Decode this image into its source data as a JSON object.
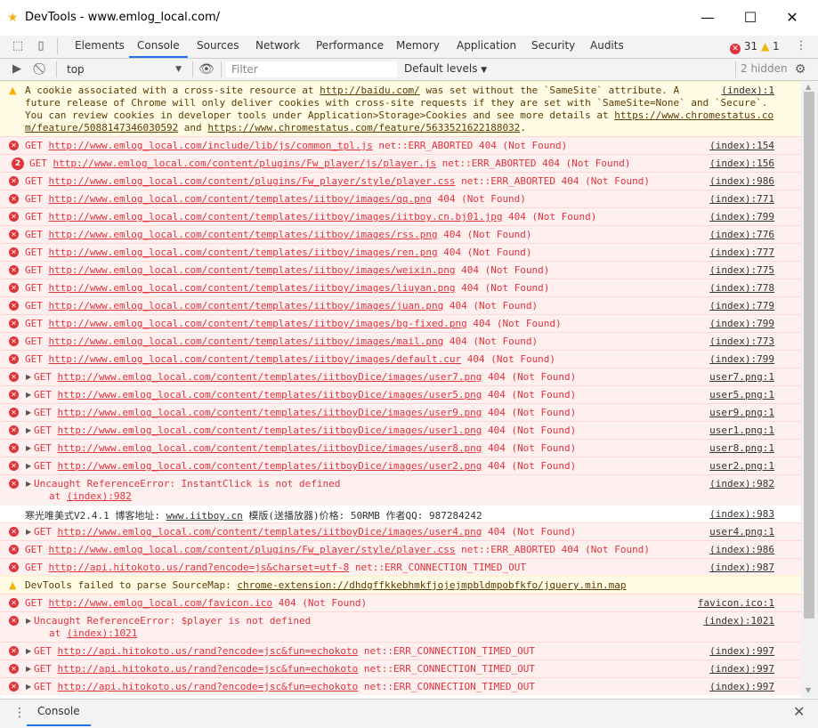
{
  "window": {
    "title": "DevTools - www.emlog_local.com/",
    "minimize": "—",
    "maximize": "☐",
    "close": "✕"
  },
  "tabs": [
    "Elements",
    "Console",
    "Sources",
    "Network",
    "Performance",
    "Memory",
    "Application",
    "Security",
    "Audits"
  ],
  "active_tab": "Console",
  "counters": {
    "errors": "31",
    "warnings": "1"
  },
  "toolbar": {
    "context": "top",
    "filter_placeholder": "Filter",
    "levels": "Default levels",
    "hidden": "2 hidden"
  },
  "colors": {
    "error_text": "#e0333c",
    "error_bg": "#fff0f0",
    "warn_bg": "#fffbe5",
    "accent": "#1a73e8"
  },
  "messages": [
    {
      "type": "warn",
      "lines": [
        "A cookie associated with a cross-site resource at <u>http://baidu.com/</u> was set without the `SameSite` attribute. A",
        "future release of Chrome will only deliver cookies with cross-site requests if they are set with `SameSite=None` and `Secure`.",
        "You can review cookies in developer tools under Application>Storage>Cookies and see more details at <u>https://www.chromestatus.co</u>",
        "<u>m/feature/5088147346030592</u> and <u>https://www.chromestatus.com/feature/5633521622188032</u>."
      ],
      "source": "(index):1"
    },
    {
      "type": "error",
      "text": "GET <u>http://www.emlog_local.com/include/lib/js/common_tpl.js</u> net::ERR_ABORTED 404 (Not Found)",
      "source": "(index):154"
    },
    {
      "type": "error",
      "count": "2",
      "text": "GET <u>http://www.emlog_local.com/content/plugins/Fw_player/js/player.js</u> net::ERR_ABORTED 404 (Not Found)",
      "source": "(index):156"
    },
    {
      "type": "error",
      "text": "GET <u>http://www.emlog_local.com/content/plugins/Fw_player/style/player.css</u> net::ERR_ABORTED 404 (Not Found)",
      "source": "(index):986"
    },
    {
      "type": "error",
      "text": "GET <u>http://www.emlog_local.com/content/templates/iitboy/images/qq.png</u> 404 (Not Found)",
      "source": "(index):771"
    },
    {
      "type": "error",
      "text": "GET <u>http://www.emlog_local.com/content/templates/iitboy/images/iitboy.cn.bj01.jpg</u> 404 (Not Found)",
      "source": "(index):799"
    },
    {
      "type": "error",
      "text": "GET <u>http://www.emlog_local.com/content/templates/iitboy/images/rss.png</u> 404 (Not Found)",
      "source": "(index):776"
    },
    {
      "type": "error",
      "text": "GET <u>http://www.emlog_local.com/content/templates/iitboy/images/ren.png</u> 404 (Not Found)",
      "source": "(index):777"
    },
    {
      "type": "error",
      "text": "GET <u>http://www.emlog_local.com/content/templates/iitboy/images/weixin.png</u> 404 (Not Found)",
      "source": "(index):775"
    },
    {
      "type": "error",
      "text": "GET <u>http://www.emlog_local.com/content/templates/iitboy/images/liuyan.png</u> 404 (Not Found)",
      "source": "(index):778"
    },
    {
      "type": "error",
      "text": "GET <u>http://www.emlog_local.com/content/templates/iitboy/images/juan.png</u> 404 (Not Found)",
      "source": "(index):779"
    },
    {
      "type": "error",
      "text": "GET <u>http://www.emlog_local.com/content/templates/iitboy/images/bg-fixed.png</u> 404 (Not Found)",
      "source": "(index):799"
    },
    {
      "type": "error",
      "text": "GET <u>http://www.emlog_local.com/content/templates/iitboy/images/mail.png</u> 404 (Not Found)",
      "source": "(index):773"
    },
    {
      "type": "error",
      "text": "GET <u>http://www.emlog_local.com/content/templates/iitboy/images/default.cur</u> 404 (Not Found)",
      "source": "(index):799"
    },
    {
      "type": "error",
      "expand": true,
      "text": "GET <u>http://www.emlog_local.com/content/templates/iitboyDice/images/user7.png</u> 404 (Not Found)",
      "source": "user7.png:1"
    },
    {
      "type": "error",
      "expand": true,
      "text": "GET <u>http://www.emlog_local.com/content/templates/iitboyDice/images/user5.png</u> 404 (Not Found)",
      "source": "user5.png:1"
    },
    {
      "type": "error",
      "expand": true,
      "text": "GET <u>http://www.emlog_local.com/content/templates/iitboyDice/images/user9.png</u> 404 (Not Found)",
      "source": "user9.png:1"
    },
    {
      "type": "error",
      "expand": true,
      "text": "GET <u>http://www.emlog_local.com/content/templates/iitboyDice/images/user1.png</u> 404 (Not Found)",
      "source": "user1.png:1"
    },
    {
      "type": "error",
      "expand": true,
      "text": "GET <u>http://www.emlog_local.com/content/templates/iitboyDice/images/user8.png</u> 404 (Not Found)",
      "source": "user8.png:1"
    },
    {
      "type": "error",
      "expand": true,
      "text": "GET <u>http://www.emlog_local.com/content/templates/iitboyDice/images/user2.png</u> 404 (Not Found)",
      "source": "user2.png:1"
    },
    {
      "type": "error",
      "expand": true,
      "text": "Uncaught ReferenceError: InstantClick is not defined",
      "at": "at <u>(index):982</u>",
      "source": "(index):982"
    },
    {
      "type": "log",
      "text": "寒光唯美式V2.4.1 博客地址: <u>www.iitboy.cn</u> 模版(送播放器)价格: 50RMB 作者QQ: 987284242",
      "source": "(index):983"
    },
    {
      "type": "error",
      "expand": true,
      "text": "GET <u>http://www.emlog_local.com/content/templates/iitboyDice/images/user4.png</u> 404 (Not Found)",
      "source": "user4.png:1"
    },
    {
      "type": "error",
      "text": "GET <u>http://www.emlog_local.com/content/plugins/Fw_player/style/player.css</u> net::ERR_ABORTED 404 (Not Found)",
      "source": "(index):986"
    },
    {
      "type": "error",
      "text": "GET <u>http://api.hitokoto.us/rand?encode=js&charset=utf-8</u> net::ERR_CONNECTION_TIMED_OUT",
      "source": "(index):987"
    },
    {
      "type": "warn",
      "text": "DevTools failed to parse SourceMap: <u>chrome-extension://dhdgffkkebhmkfjojejmpbldmpobfkfo/jquery.min.map</u>",
      "source": ""
    },
    {
      "type": "error",
      "text": "GET <u>http://www.emlog_local.com/favicon.ico</u> 404 (Not Found)",
      "source": "favicon.ico:1"
    },
    {
      "type": "error",
      "expand": true,
      "text": "Uncaught ReferenceError: $player is not defined",
      "at": "at <u>(index):1021</u>",
      "source": "(index):1021"
    },
    {
      "type": "error",
      "expand": true,
      "text": "GET <u>http://api.hitokoto.us/rand?encode=jsc&fun=echokoto</u> net::ERR_CONNECTION_TIMED_OUT",
      "source": "(index):997"
    },
    {
      "type": "error",
      "expand": true,
      "text": "GET <u>http://api.hitokoto.us/rand?encode=jsc&fun=echokoto</u> net::ERR_CONNECTION_TIMED_OUT",
      "source": "(index):997"
    },
    {
      "type": "error",
      "expand": true,
      "text": "GET <u>http://api.hitokoto.us/rand?encode=jsc&fun=echokoto</u> net::ERR_CONNECTION_TIMED_OUT",
      "source": "(index):997"
    }
  ],
  "drawer": {
    "tab": "Console"
  }
}
